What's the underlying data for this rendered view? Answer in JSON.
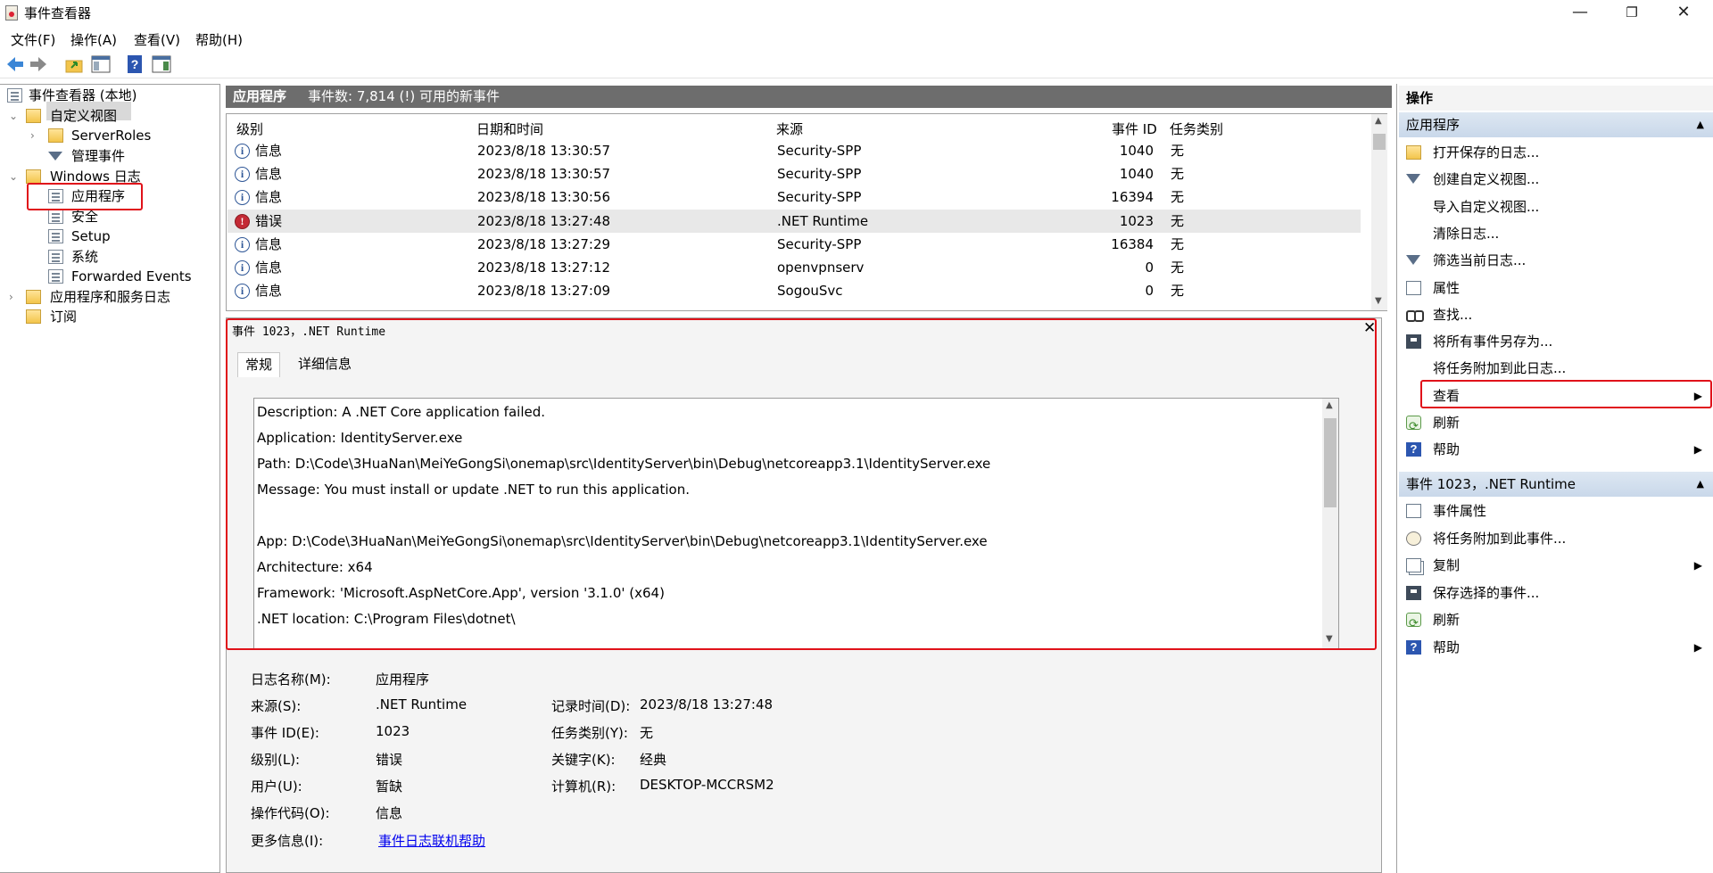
{
  "window": {
    "title": "事件查看器",
    "controls": {
      "minimize": "—",
      "maximize": "❐",
      "close": "✕"
    }
  },
  "menu": [
    "文件(F)",
    "操作(A)",
    "查看(V)",
    "帮助(H)"
  ],
  "toolbar": [
    "back-icon",
    "forward-icon",
    "up-folder-icon",
    "show-hide-tree-icon",
    "help-icon",
    "show-hide-action-pane-icon"
  ],
  "tree": {
    "root": "事件查看器 (本地)",
    "custom_views": "自定义视图",
    "server_roles": "ServerRoles",
    "admin_events": "管理事件",
    "windows_logs": "Windows 日志",
    "application": "应用程序",
    "security": "安全",
    "setup": "Setup",
    "system": "系统",
    "forwarded": "Forwarded Events",
    "apps_services": "应用程序和服务日志",
    "subscriptions": "订阅"
  },
  "log_header": {
    "name": "应用程序",
    "summary": "事件数: 7,814 (!) 可用的新事件"
  },
  "table": {
    "columns": [
      "级别",
      "日期和时间",
      "来源",
      "事件 ID",
      "任务类别"
    ],
    "rows": [
      {
        "level": "信息",
        "type": "info",
        "datetime": "2023/8/18 13:30:57",
        "source": "Security-SPP",
        "id": "1040",
        "task": "无"
      },
      {
        "level": "信息",
        "type": "info",
        "datetime": "2023/8/18 13:30:57",
        "source": "Security-SPP",
        "id": "1040",
        "task": "无"
      },
      {
        "level": "信息",
        "type": "info",
        "datetime": "2023/8/18 13:30:56",
        "source": "Security-SPP",
        "id": "16394",
        "task": "无"
      },
      {
        "level": "错误",
        "type": "error",
        "datetime": "2023/8/18 13:27:48",
        "source": ".NET Runtime",
        "id": "1023",
        "task": "无"
      },
      {
        "level": "信息",
        "type": "info",
        "datetime": "2023/8/18 13:27:29",
        "source": "Security-SPP",
        "id": "16384",
        "task": "无"
      },
      {
        "level": "信息",
        "type": "info",
        "datetime": "2023/8/18 13:27:12",
        "source": "openvpnserv",
        "id": "0",
        "task": "无"
      },
      {
        "level": "信息",
        "type": "info",
        "datetime": "2023/8/18 13:27:09",
        "source": "SogouSvc",
        "id": "0",
        "task": "无"
      }
    ],
    "selected_row": 3
  },
  "detail": {
    "title": "事件 1023，.NET Runtime",
    "tabs": [
      "常规",
      "详细信息"
    ],
    "description": [
      "Description: A .NET Core application failed.",
      "Application: IdentityServer.exe",
      "Path: D:\\Code\\3HuaNan\\MeiYeGongSi\\onemap\\src\\IdentityServer\\bin\\Debug\\netcoreapp3.1\\IdentityServer.exe",
      "Message: You must install or update .NET to run this application.",
      "",
      "App: D:\\Code\\3HuaNan\\MeiYeGongSi\\onemap\\src\\IdentityServer\\bin\\Debug\\netcoreapp3.1\\IdentityServer.exe",
      "Architecture: x64",
      "Framework: 'Microsoft.AspNetCore.App', version '3.1.0' (x64)",
      ".NET location: C:\\Program Files\\dotnet\\"
    ],
    "fields": {
      "log_name_label": "日志名称(M):",
      "log_name": "应用程序",
      "source_label": "来源(S):",
      "source": ".NET Runtime",
      "logged_label": "记录时间(D):",
      "logged": "2023/8/18 13:27:48",
      "event_id_label": "事件 ID(E):",
      "event_id": "1023",
      "task_label": "任务类别(Y):",
      "task": "无",
      "level_label": "级别(L):",
      "level": "错误",
      "keywords_label": "关键字(K):",
      "keywords": "经典",
      "user_label": "用户(U):",
      "user": "暂缺",
      "computer_label": "计算机(R):",
      "computer": "DESKTOP-MCCRSM2",
      "opcode_label": "操作代码(O):",
      "opcode": "信息",
      "more_info_label": "更多信息(I):",
      "more_info_link": "事件日志联机帮助"
    }
  },
  "actions": {
    "header": "操作",
    "section1": "应用程序",
    "items1": [
      {
        "label": "打开保存的日志...",
        "icon": "open-saved-log-icon"
      },
      {
        "label": "创建自定义视图...",
        "icon": "filter-icon"
      },
      {
        "label": "导入自定义视图...",
        "icon": ""
      },
      {
        "label": "清除日志...",
        "icon": ""
      },
      {
        "label": "筛选当前日志...",
        "icon": "filter-icon"
      },
      {
        "label": "属性",
        "icon": "properties-icon"
      },
      {
        "label": "查找...",
        "icon": "find-icon"
      },
      {
        "label": "将所有事件另存为...",
        "icon": "save-icon"
      },
      {
        "label": "将任务附加到此日志...",
        "icon": ""
      },
      {
        "label": "查看",
        "icon": ""
      },
      {
        "label": "刷新",
        "icon": "refresh-icon"
      },
      {
        "label": "帮助",
        "icon": "help-icon"
      }
    ],
    "section2": "事件 1023，.NET Runtime",
    "items2": [
      {
        "label": "事件属性",
        "icon": "properties-icon"
      },
      {
        "label": "将任务附加到此事件...",
        "icon": "task-icon"
      },
      {
        "label": "复制",
        "icon": "copy-icon"
      },
      {
        "label": "保存选择的事件...",
        "icon": "save-icon"
      },
      {
        "label": "刷新",
        "icon": "refresh-icon"
      },
      {
        "label": "帮助",
        "icon": "help-icon"
      }
    ]
  },
  "colors": {
    "highlight_box": "#e0121a",
    "link": "#0000ee",
    "header_gray": "#6d6d6d",
    "section_blue": "#c9d8ea"
  }
}
